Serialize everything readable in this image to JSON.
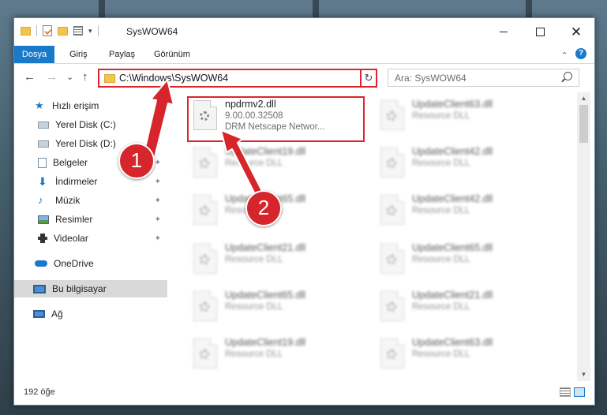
{
  "window": {
    "title": "SysWOW64",
    "min_glyph": "",
    "close_glyph": "✕"
  },
  "ribbon": {
    "tabs": [
      "Dosya",
      "Giriş",
      "Paylaş",
      "Görünüm"
    ],
    "collapse_glyph": "⌄",
    "help_glyph": "?"
  },
  "nav": {
    "back_glyph": "←",
    "forward_glyph": "→",
    "recent_glyph": "⌄",
    "up_glyph": "↑",
    "address": "C:\\Windows\\SysWOW64",
    "address_drop_glyph": "⌄",
    "refresh_glyph": "↻",
    "search_placeholder": "Ara: SysWOW64"
  },
  "sidebar": {
    "items": [
      {
        "label": "Hızlı erişim",
        "icon": "star-icon",
        "pinned": false
      },
      {
        "label": "Yerel Disk (C:)",
        "icon": "drive-icon",
        "pinned": true
      },
      {
        "label": "Yerel Disk (D:)",
        "icon": "drive-icon",
        "pinned": true
      },
      {
        "label": "Belgeler",
        "icon": "documents-icon",
        "pinned": true
      },
      {
        "label": "İndirmeler",
        "icon": "downloads-icon",
        "pinned": true
      },
      {
        "label": "Müzik",
        "icon": "music-icon",
        "pinned": true
      },
      {
        "label": "Resimler",
        "icon": "pictures-icon",
        "pinned": true
      },
      {
        "label": "Videolar",
        "icon": "videos-icon",
        "pinned": true
      },
      {
        "label": "OneDrive",
        "icon": "cloud-icon",
        "pinned": false
      },
      {
        "label": "Bu bilgisayar",
        "icon": "computer-icon",
        "pinned": false,
        "selected": true
      },
      {
        "label": "Ağ",
        "icon": "network-icon",
        "pinned": false
      }
    ],
    "pin_glyph": "📌"
  },
  "files": [
    {
      "name": "npdrmv2.dll",
      "line2": "9.00.00.32508",
      "line3": "DRM Netscape Networ..."
    },
    {
      "name": "UpdateClient63.dll",
      "line2": "Resource DLL"
    },
    {
      "name": "UpdateClient19.dll",
      "line2": "Resource DLL"
    },
    {
      "name": "UpdateClient42.dll",
      "line2": "Resource DLL"
    },
    {
      "name": "UpdateClient65.dll",
      "line2": "Resource DLL"
    },
    {
      "name": "UpdateClient42.dll",
      "line2": "Resource DLL"
    },
    {
      "name": "UpdateClient21.dll",
      "line2": "Resource DLL"
    },
    {
      "name": "UpdateClient65.dll",
      "line2": "Resource DLL"
    },
    {
      "name": "UpdateClient65.dll",
      "line2": "Resource DLL"
    },
    {
      "name": "UpdateClient21.dll",
      "line2": "Resource DLL"
    },
    {
      "name": "UpdateClient19.dll",
      "line2": "Resource DLL"
    },
    {
      "name": "UpdateClient63.dll",
      "line2": "Resource DLL"
    }
  ],
  "status": {
    "item_count": "192 öğe"
  },
  "annotations": {
    "step1": "1",
    "step2": "2",
    "color": "#d7262b"
  },
  "colors": {
    "accent": "#1979ca",
    "highlight": "#d9262c"
  }
}
